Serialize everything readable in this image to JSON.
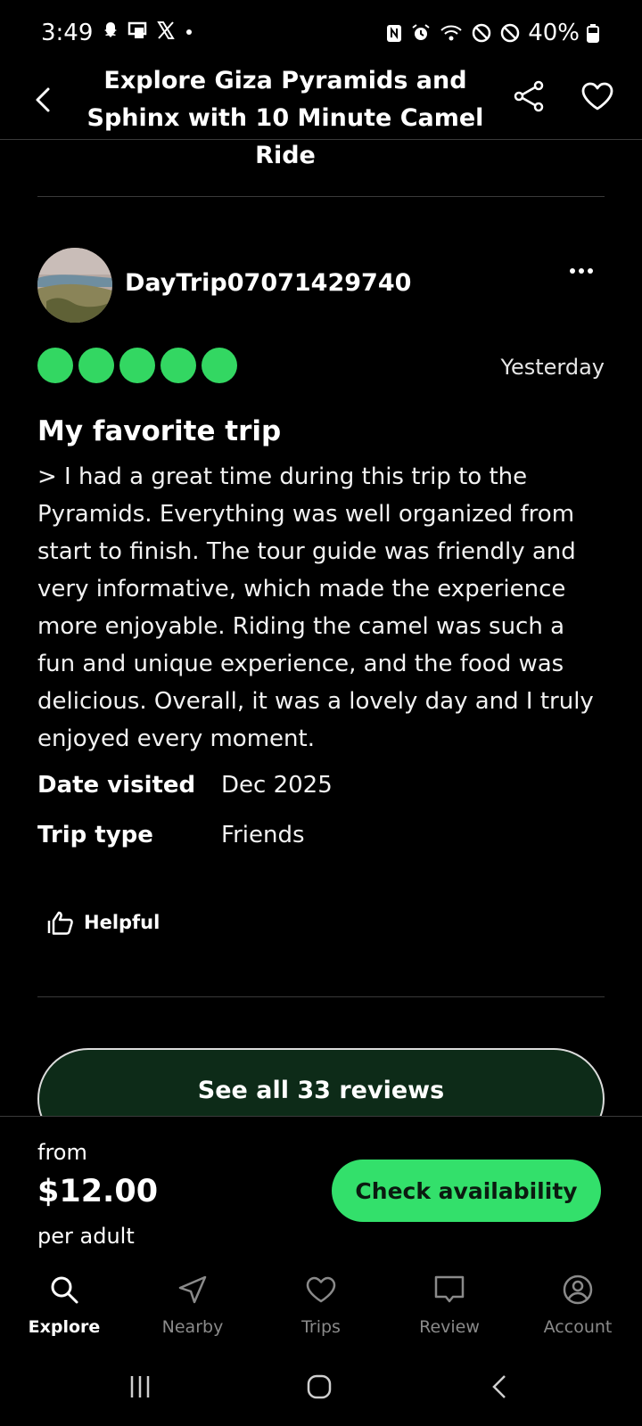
{
  "status_bar": {
    "time": "3:49",
    "battery": "40%",
    "icons_left": [
      "snapchat-icon",
      "messenger-icon",
      "x-icon",
      "dot-icon"
    ],
    "icons_right": [
      "nfc-icon",
      "alarm-icon",
      "wifi-icon",
      "dnd-icon",
      "block-icon",
      "battery-icon"
    ]
  },
  "header": {
    "title": "Explore Giza Pyramids and Sphinx with 10 Minute Camel Ride"
  },
  "review": {
    "username": "DayTrip07071429740",
    "rating": 5,
    "rating_max": 5,
    "rating_color": "#33d762",
    "date": "Yesterday",
    "title": "My favorite trip",
    "body": "> I had a great time during this trip to the Pyramids. Everything was well organized from start to finish. The tour guide was friendly and very informative, which made the experience more enjoyable. Riding the camel was such a fun and unique experience, and the food was delicious. Overall, it was a lovely day and I truly enjoyed every moment.",
    "meta": [
      {
        "label": "Date visited",
        "value": "Dec 2025"
      },
      {
        "label": "Trip type",
        "value": "Friends"
      }
    ],
    "helpful_label": "Helpful"
  },
  "see_all_label": "See all 33 reviews",
  "booking": {
    "from_label": "from",
    "price": "$12.00",
    "per_label": "per adult",
    "cta_label": "Check availability",
    "cta_color": "#33e06b"
  },
  "bottom_nav": [
    {
      "label": "Explore",
      "icon": "search-icon",
      "active": true
    },
    {
      "label": "Nearby",
      "icon": "navigation-icon",
      "active": false
    },
    {
      "label": "Trips",
      "icon": "heart-icon",
      "active": false
    },
    {
      "label": "Review",
      "icon": "message-icon",
      "active": false
    },
    {
      "label": "Account",
      "icon": "account-icon",
      "active": false
    }
  ]
}
